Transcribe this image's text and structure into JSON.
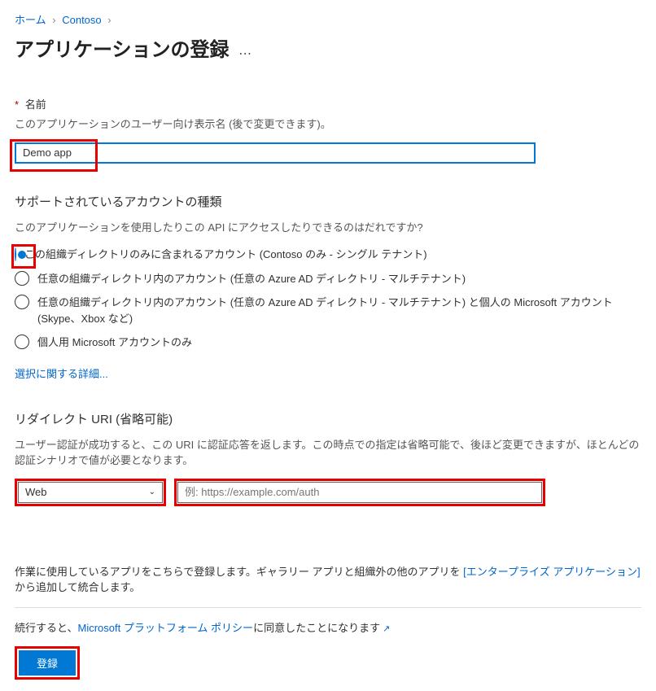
{
  "breadcrumb": {
    "home": "ホーム",
    "org": "Contoso"
  },
  "page_title": "アプリケーションの登録",
  "title_menu": "⋯",
  "name_section": {
    "label": "名前",
    "help": "このアプリケーションのユーザー向け表示名 (後で変更できます)。",
    "value": "Demo app"
  },
  "accounts_section": {
    "heading": "サポートされているアカウントの種類",
    "help": "このアプリケーションを使用したりこの API にアクセスしたりできるのはだれですか?",
    "options": [
      "この組織ディレクトリのみに含まれるアカウント (Contoso のみ - シングル テナント)",
      "任意の組織ディレクトリ内のアカウント (任意の Azure AD ディレクトリ - マルチテナント)",
      "任意の組織ディレクトリ内のアカウント (任意の Azure AD ディレクトリ - マルチテナント) と個人の Microsoft アカウント (Skype、Xbox など)",
      "個人用 Microsoft アカウントのみ"
    ],
    "detail_link": "選択に関する詳細..."
  },
  "redirect_section": {
    "heading": "リダイレクト URI (省略可能)",
    "help": "ユーザー認証が成功すると、この URI に認証応答を返します。この時点での指定は省略可能で、後ほど変更できますが、ほとんどの認証シナリオで値が必要となります。",
    "platform_value": "Web",
    "uri_placeholder": "例: https://example.com/auth"
  },
  "bottom": {
    "text_before": "作業に使用しているアプリをこちらで登録します。ギャラリー アプリと組織外の他のアプリを ",
    "link": "[エンタープライズ アプリケーション]",
    "text_after": " から追加して統合します。"
  },
  "footer": {
    "policy_before": "続行すると、",
    "policy_link": "Microsoft プラットフォーム ポリシー",
    "policy_after": "に同意したことになります",
    "register_button": "登録"
  }
}
